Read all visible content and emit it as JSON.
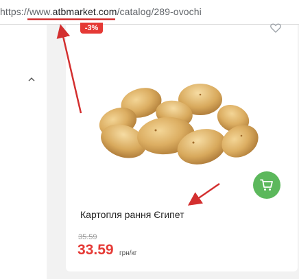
{
  "address_bar": {
    "url_prefix": "https://www.",
    "url_domain": "atbmarket.com",
    "url_path": "/catalog/289-ovochi"
  },
  "sidebar": {
    "chevron_icon": "chevron-up-icon"
  },
  "product": {
    "discount_badge": "-3%",
    "name": "Картопля рання Єгипет",
    "old_price": "35.59",
    "current_price": "33.59",
    "price_unit": "грн/кг",
    "image_icon": "potatoes-image",
    "wishlist_icon": "heart-outline-icon",
    "cart_icon": "cart-icon"
  },
  "colors": {
    "badge": "#e53935",
    "price": "#e53935",
    "cart_button": "#5cb85c",
    "annotation": "#d32f2f"
  }
}
